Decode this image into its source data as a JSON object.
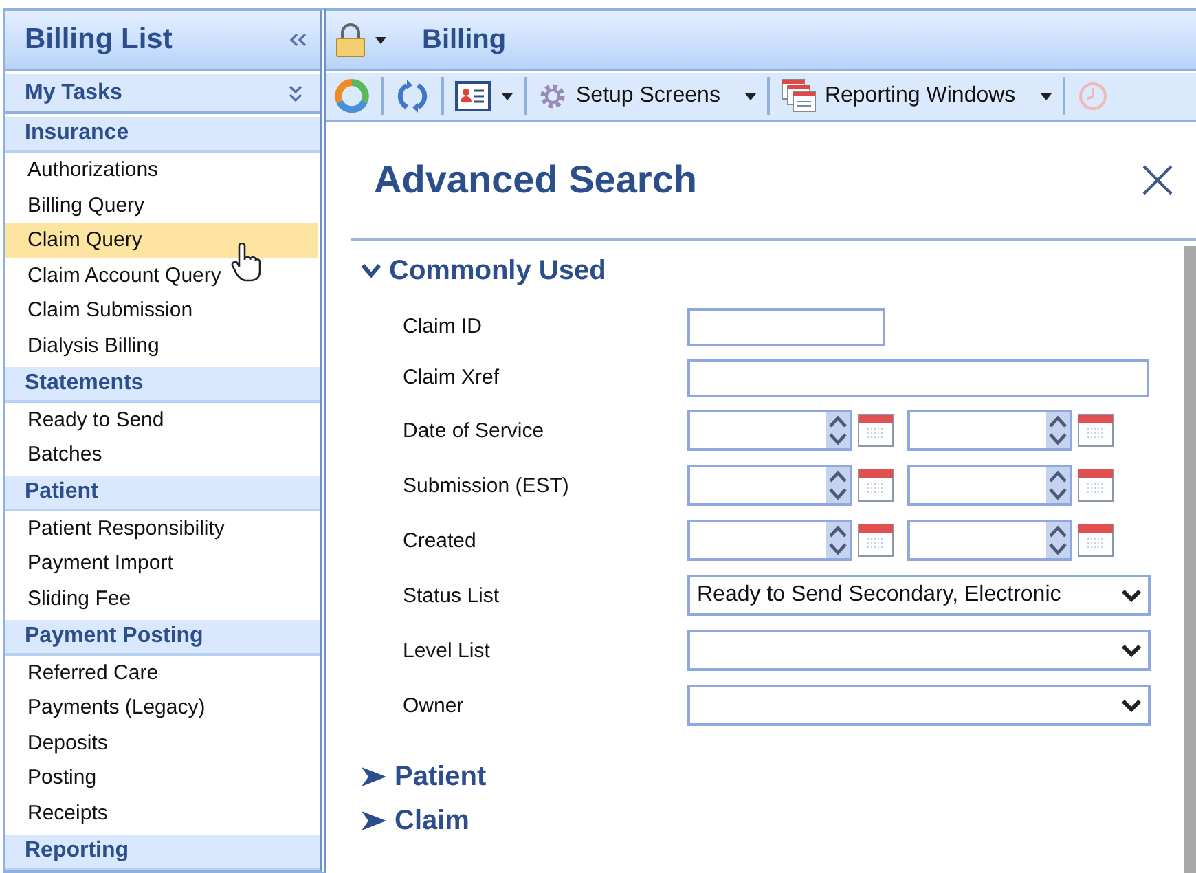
{
  "sidebar": {
    "title": "Billing List",
    "panel": "My Tasks",
    "sections": [
      {
        "title": "Insurance",
        "items": [
          {
            "label": "Authorizations",
            "selected": false
          },
          {
            "label": "Billing Query",
            "selected": false
          },
          {
            "label": "Claim Query",
            "selected": true
          },
          {
            "label": "Claim Account Query",
            "selected": false
          },
          {
            "label": "Claim Submission",
            "selected": false
          },
          {
            "label": "Dialysis Billing",
            "selected": false
          }
        ]
      },
      {
        "title": "Statements",
        "items": [
          {
            "label": "Ready to Send",
            "selected": false
          },
          {
            "label": "Batches",
            "selected": false
          }
        ]
      },
      {
        "title": "Patient",
        "items": [
          {
            "label": "Patient Responsibility",
            "selected": false
          },
          {
            "label": "Payment Import",
            "selected": false
          },
          {
            "label": "Sliding Fee",
            "selected": false
          }
        ]
      },
      {
        "title": "Payment Posting",
        "items": [
          {
            "label": "Referred Care",
            "selected": false
          },
          {
            "label": "Payments (Legacy)",
            "selected": false
          },
          {
            "label": "Deposits",
            "selected": false
          },
          {
            "label": "Posting",
            "selected": false
          },
          {
            "label": "Receipts",
            "selected": false
          }
        ]
      },
      {
        "title": "Reporting"
      }
    ]
  },
  "header": {
    "title": "Billing"
  },
  "toolbar": {
    "setup": "Setup Screens",
    "reporting": "Reporting Windows"
  },
  "dialog": {
    "title": "Advanced Search",
    "sections": [
      {
        "title": "Commonly Used",
        "expanded": true,
        "fields": [
          {
            "label": "Claim ID",
            "kind": "text"
          },
          {
            "label": "Claim Xref",
            "kind": "wide"
          },
          {
            "label": "Date of Service",
            "kind": "date-range"
          },
          {
            "label": "Submission (EST)",
            "kind": "date-range"
          },
          {
            "label": "Created",
            "kind": "date-range"
          },
          {
            "label": "Status List",
            "kind": "select",
            "value": "Ready to Send Secondary, Electronic"
          },
          {
            "label": "Level List",
            "kind": "select"
          },
          {
            "label": "Owner",
            "kind": "select"
          }
        ]
      },
      {
        "title": "Patient",
        "expanded": false
      },
      {
        "title": "Claim",
        "expanded": false
      }
    ]
  }
}
